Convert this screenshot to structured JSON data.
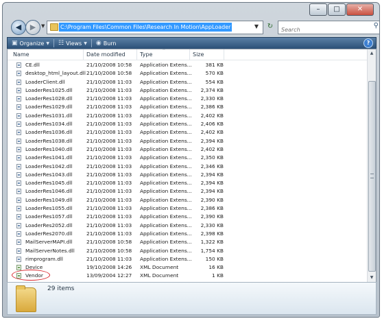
{
  "window": {
    "controls": {
      "minimize": "–",
      "maximize": "□",
      "close": "✕"
    }
  },
  "address": {
    "back_icon": "back-arrow-icon",
    "forward_icon": "forward-arrow-icon",
    "path": "C:\\Program Files\\Common Files\\Research In Motion\\AppLoader",
    "refresh_glyph": "↻"
  },
  "search": {
    "placeholder": "Search"
  },
  "toolbar": {
    "organize": "Organize",
    "views": "Views",
    "burn": "Burn",
    "help": "?"
  },
  "columns": {
    "name": "Name",
    "date": "Date modified",
    "type": "Type",
    "size": "Size"
  },
  "files": [
    {
      "name": "CE.dll",
      "date": "21/10/2008 10:58",
      "type": "Application Extens...",
      "size": "381 KB",
      "icon": "dll-file-icon"
    },
    {
      "name": "desktop_html_layout.dll",
      "date": "21/10/2008 10:58",
      "type": "Application Extens...",
      "size": "570 KB",
      "icon": "dll-file-icon"
    },
    {
      "name": "LoaderClient.dll",
      "date": "21/10/2008 11:03",
      "type": "Application Extens...",
      "size": "554 KB",
      "icon": "dll-file-icon"
    },
    {
      "name": "LoaderRes1025.dll",
      "date": "21/10/2008 11:03",
      "type": "Application Extens...",
      "size": "2,374 KB",
      "icon": "dll-file-icon"
    },
    {
      "name": "LoaderRes1028.dll",
      "date": "21/10/2008 11:03",
      "type": "Application Extens...",
      "size": "2,330 KB",
      "icon": "dll-file-icon"
    },
    {
      "name": "LoaderRes1029.dll",
      "date": "21/10/2008 11:03",
      "type": "Application Extens...",
      "size": "2,386 KB",
      "icon": "dll-file-icon"
    },
    {
      "name": "LoaderRes1031.dll",
      "date": "21/10/2008 11:03",
      "type": "Application Extens...",
      "size": "2,402 KB",
      "icon": "dll-file-icon"
    },
    {
      "name": "LoaderRes1034.dll",
      "date": "21/10/2008 11:03",
      "type": "Application Extens...",
      "size": "2,406 KB",
      "icon": "dll-file-icon"
    },
    {
      "name": "LoaderRes1036.dll",
      "date": "21/10/2008 11:03",
      "type": "Application Extens...",
      "size": "2,402 KB",
      "icon": "dll-file-icon"
    },
    {
      "name": "LoaderRes1038.dll",
      "date": "21/10/2008 11:03",
      "type": "Application Extens...",
      "size": "2,394 KB",
      "icon": "dll-file-icon"
    },
    {
      "name": "LoaderRes1040.dll",
      "date": "21/10/2008 11:03",
      "type": "Application Extens...",
      "size": "2,402 KB",
      "icon": "dll-file-icon"
    },
    {
      "name": "LoaderRes1041.dll",
      "date": "21/10/2008 11:03",
      "type": "Application Extens...",
      "size": "2,350 KB",
      "icon": "dll-file-icon"
    },
    {
      "name": "LoaderRes1042.dll",
      "date": "21/10/2008 11:03",
      "type": "Application Extens...",
      "size": "2,346 KB",
      "icon": "dll-file-icon"
    },
    {
      "name": "LoaderRes1043.dll",
      "date": "21/10/2008 11:03",
      "type": "Application Extens...",
      "size": "2,394 KB",
      "icon": "dll-file-icon"
    },
    {
      "name": "LoaderRes1045.dll",
      "date": "21/10/2008 11:03",
      "type": "Application Extens...",
      "size": "2,394 KB",
      "icon": "dll-file-icon"
    },
    {
      "name": "LoaderRes1046.dll",
      "date": "21/10/2008 11:03",
      "type": "Application Extens...",
      "size": "2,394 KB",
      "icon": "dll-file-icon"
    },
    {
      "name": "LoaderRes1049.dll",
      "date": "21/10/2008 11:03",
      "type": "Application Extens...",
      "size": "2,390 KB",
      "icon": "dll-file-icon"
    },
    {
      "name": "LoaderRes1055.dll",
      "date": "21/10/2008 11:03",
      "type": "Application Extens...",
      "size": "2,386 KB",
      "icon": "dll-file-icon"
    },
    {
      "name": "LoaderRes1057.dll",
      "date": "21/10/2008 11:03",
      "type": "Application Extens...",
      "size": "2,390 KB",
      "icon": "dll-file-icon"
    },
    {
      "name": "LoaderRes2052.dll",
      "date": "21/10/2008 11:03",
      "type": "Application Extens...",
      "size": "2,330 KB",
      "icon": "dll-file-icon"
    },
    {
      "name": "LoaderRes2070.dll",
      "date": "21/10/2008 11:03",
      "type": "Application Extens...",
      "size": "2,398 KB",
      "icon": "dll-file-icon"
    },
    {
      "name": "MailServerMAPI.dll",
      "date": "21/10/2008 10:58",
      "type": "Application Extens...",
      "size": "1,322 KB",
      "icon": "dll-file-icon"
    },
    {
      "name": "MailServerNotes.dll",
      "date": "21/10/2008 10:58",
      "type": "Application Extens...",
      "size": "1,754 KB",
      "icon": "dll-file-icon"
    },
    {
      "name": "rimprogram.dll",
      "date": "21/10/2008 11:03",
      "type": "Application Extens...",
      "size": "150 KB",
      "icon": "dll-file-icon"
    },
    {
      "name": "Device",
      "date": "19/10/2008 14:26",
      "type": "XML Document",
      "size": "16 KB",
      "icon": "xml-file-icon"
    },
    {
      "name": "Vendor",
      "date": "13/09/2004 12:27",
      "type": "XML Document",
      "size": "1 KB",
      "icon": "xml-file-icon",
      "circled": true
    }
  ],
  "status": {
    "item_count": "29 items"
  },
  "colors": {
    "toolbar": "#2b4f77",
    "selection": "#3399ff",
    "annotation": "#d9262c"
  }
}
